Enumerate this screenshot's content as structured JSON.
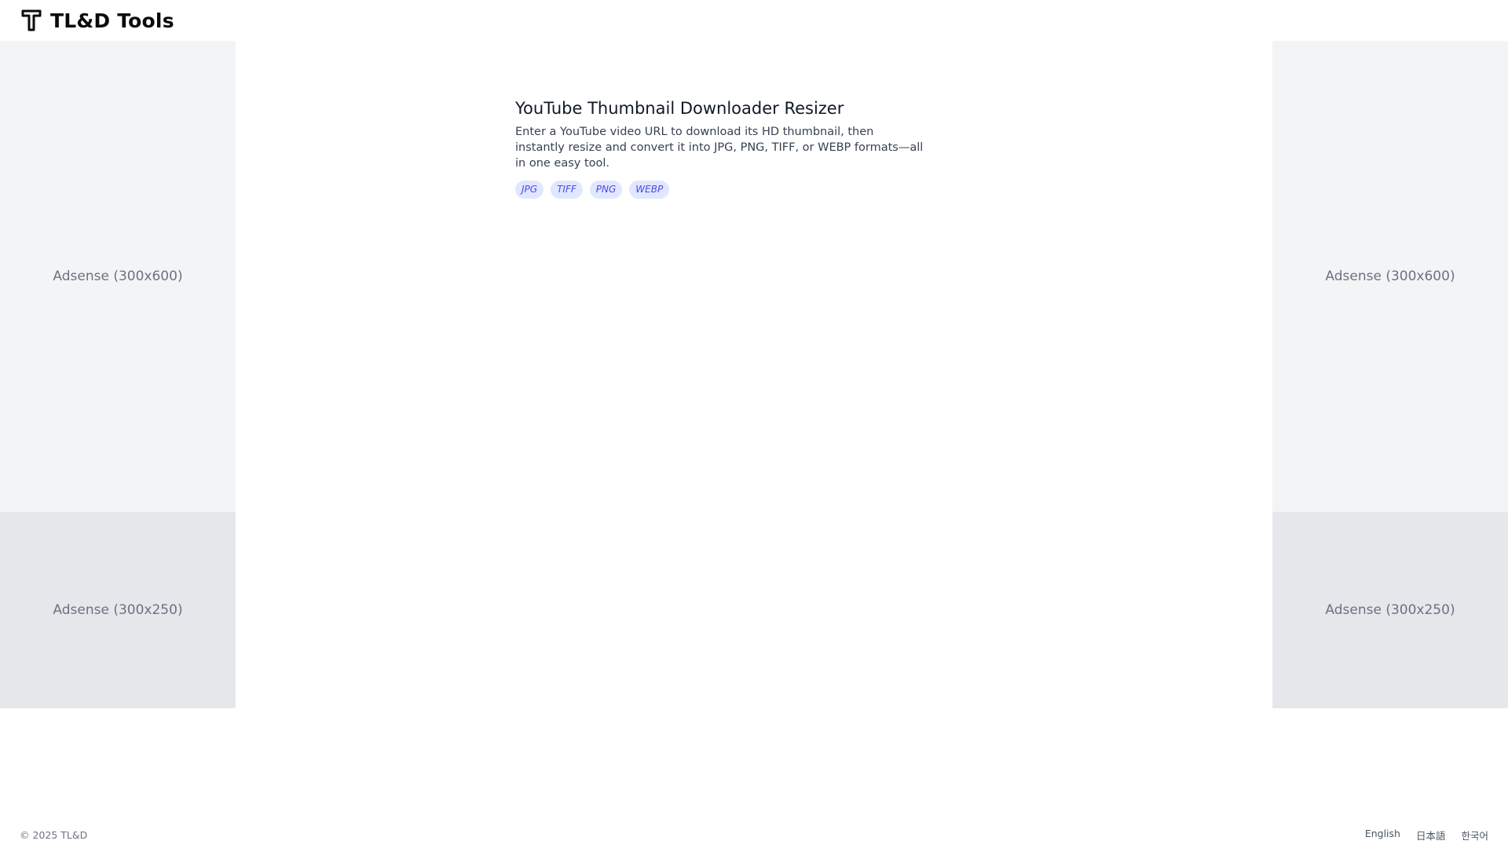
{
  "header": {
    "brand": "TL&D Tools",
    "logo_icon": "t-hammer-icon"
  },
  "ads": {
    "left_tall": "Adsense (300x600)",
    "left_short": "Adsense (300x250)",
    "right_tall": "Adsense (300x600)",
    "right_short": "Adsense (300x250)"
  },
  "tool": {
    "title": "YouTube Thumbnail Downloader Resizer",
    "description": "Enter a YouTube video URL to download its HD thumbnail, then instantly resize and convert it into JPG, PNG, TIFF, or WEBP formats—all in one easy tool.",
    "tags": [
      "JPG",
      "TIFF",
      "PNG",
      "WEBP"
    ]
  },
  "footer": {
    "copyright": "© 2025 TL&D",
    "languages": [
      "English",
      "日本語",
      "한국어"
    ]
  },
  "colors": {
    "tag_bg": "#e0e7ff",
    "tag_text": "#4f46e5",
    "ad_tall_bg": "#f3f4f6",
    "ad_short_bg": "#e5e7eb"
  }
}
